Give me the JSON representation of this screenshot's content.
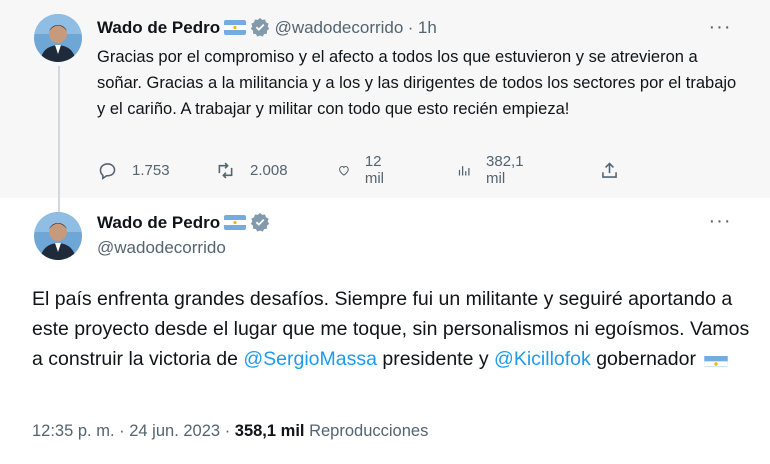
{
  "first_tweet": {
    "author_name": "Wado de Pedro",
    "handle": "@wadodecorrido",
    "separator": "·",
    "time": "1h",
    "more_label": "···",
    "text": "Gracias por el compromiso y el afecto a todos los que estuvieron y se atrevieron a soñar. Gracias a la militancia y a los y las dirigentes de todos los sectores por el trabajo y el cariño. A trabajar y militar con todo que esto recién empieza!",
    "replies": "1.753",
    "retweets": "2.008",
    "likes": "12 mil",
    "views": "382,1 mil"
  },
  "main_tweet": {
    "author_name": "Wado de Pedro",
    "handle": "@wadodecorrido",
    "more_label": "···",
    "text_before": "El país enfrenta grandes desafíos. Siempre fui un militante y seguiré aportando a este proyecto desde el lugar que me toque, sin personalismos ni egoísmos. Vamos a construir la victoria de ",
    "mention1": "@SergioMassa",
    "text_middle": " presidente y ",
    "mention2": "@Kicillofok",
    "text_after": " gobernador",
    "time": "12:35 p. m.",
    "dot": "·",
    "date": "24 jun. 2023",
    "views_count": "358,1 mil",
    "views_label": "Reproducciones"
  },
  "colors": {
    "accent": "#1d9bf0",
    "verified": "#829aab",
    "flag_blue": "#74acdf",
    "flag_sun": "#f6b40e"
  },
  "icons": [
    "reply-icon",
    "retweet-icon",
    "like-icon",
    "views-icon",
    "share-icon",
    "verified-icon",
    "argentina-flag-icon",
    "more-icon"
  ]
}
